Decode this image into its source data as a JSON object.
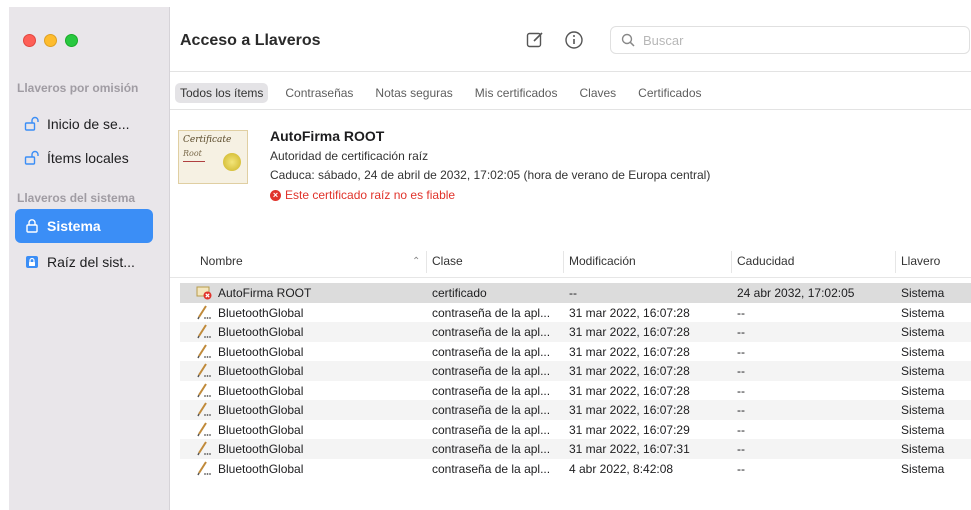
{
  "sidebar": {
    "section_default": "Llaveros por omisión",
    "section_system": "Llaveros del sistema",
    "items": [
      {
        "label": "Inicio de se...",
        "icon": "unlock-icon"
      },
      {
        "label": "Ítems locales",
        "icon": "unlock-icon"
      },
      {
        "label": "Sistema",
        "icon": "lock-icon"
      },
      {
        "label": "Raíz del sist...",
        "icon": "lock-box-icon"
      }
    ]
  },
  "toolbar": {
    "title": "Acceso a Llaveros",
    "search_placeholder": "Buscar"
  },
  "tabs": [
    "Todos los ítems",
    "Contraseñas",
    "Notas seguras",
    "Mis certificados",
    "Claves",
    "Certificados"
  ],
  "detail": {
    "name": "AutoFirma ROOT",
    "type": "Autoridad de certificación raíz",
    "expires": "Caduca: sábado, 24 de abril de 2032, 17:02:05 (hora de verano de Europa central)",
    "warning": "Este certificado raíz no es fiable",
    "thumb_line1": "Certificate",
    "thumb_line2": "Root"
  },
  "table": {
    "columns": [
      "Nombre",
      "Clase",
      "Modificación",
      "Caducidad",
      "Llavero"
    ],
    "rows": [
      {
        "name": "AutoFirma ROOT",
        "clase": "certificado",
        "mod": "--",
        "cad": "24 abr 2032, 17:02:05",
        "llavero": "Sistema",
        "icon": "certificate-error-icon"
      },
      {
        "name": "BluetoothGlobal",
        "clase": "contraseña de la apl...",
        "mod": "31 mar 2022, 16:07:28",
        "cad": "--",
        "llavero": "Sistema",
        "icon": "app-password-icon"
      },
      {
        "name": "BluetoothGlobal",
        "clase": "contraseña de la apl...",
        "mod": "31 mar 2022, 16:07:28",
        "cad": "--",
        "llavero": "Sistema",
        "icon": "app-password-icon"
      },
      {
        "name": "BluetoothGlobal",
        "clase": "contraseña de la apl...",
        "mod": "31 mar 2022, 16:07:28",
        "cad": "--",
        "llavero": "Sistema",
        "icon": "app-password-icon"
      },
      {
        "name": "BluetoothGlobal",
        "clase": "contraseña de la apl...",
        "mod": "31 mar 2022, 16:07:28",
        "cad": "--",
        "llavero": "Sistema",
        "icon": "app-password-icon"
      },
      {
        "name": "BluetoothGlobal",
        "clase": "contraseña de la apl...",
        "mod": "31 mar 2022, 16:07:28",
        "cad": "--",
        "llavero": "Sistema",
        "icon": "app-password-icon"
      },
      {
        "name": "BluetoothGlobal",
        "clase": "contraseña de la apl...",
        "mod": "31 mar 2022, 16:07:28",
        "cad": "--",
        "llavero": "Sistema",
        "icon": "app-password-icon"
      },
      {
        "name": "BluetoothGlobal",
        "clase": "contraseña de la apl...",
        "mod": "31 mar 2022, 16:07:29",
        "cad": "--",
        "llavero": "Sistema",
        "icon": "app-password-icon"
      },
      {
        "name": "BluetoothGlobal",
        "clase": "contraseña de la apl...",
        "mod": "31 mar 2022, 16:07:31",
        "cad": "--",
        "llavero": "Sistema",
        "icon": "app-password-icon"
      },
      {
        "name": "BluetoothGlobal",
        "clase": "contraseña de la apl...",
        "mod": "4 abr 2022, 8:42:08",
        "cad": "--",
        "llavero": "Sistema",
        "icon": "app-password-icon"
      }
    ]
  },
  "colors": {
    "accent": "#3b8ef6",
    "warning": "#e0332b",
    "sidebar_bg": "#e9e6ea"
  }
}
